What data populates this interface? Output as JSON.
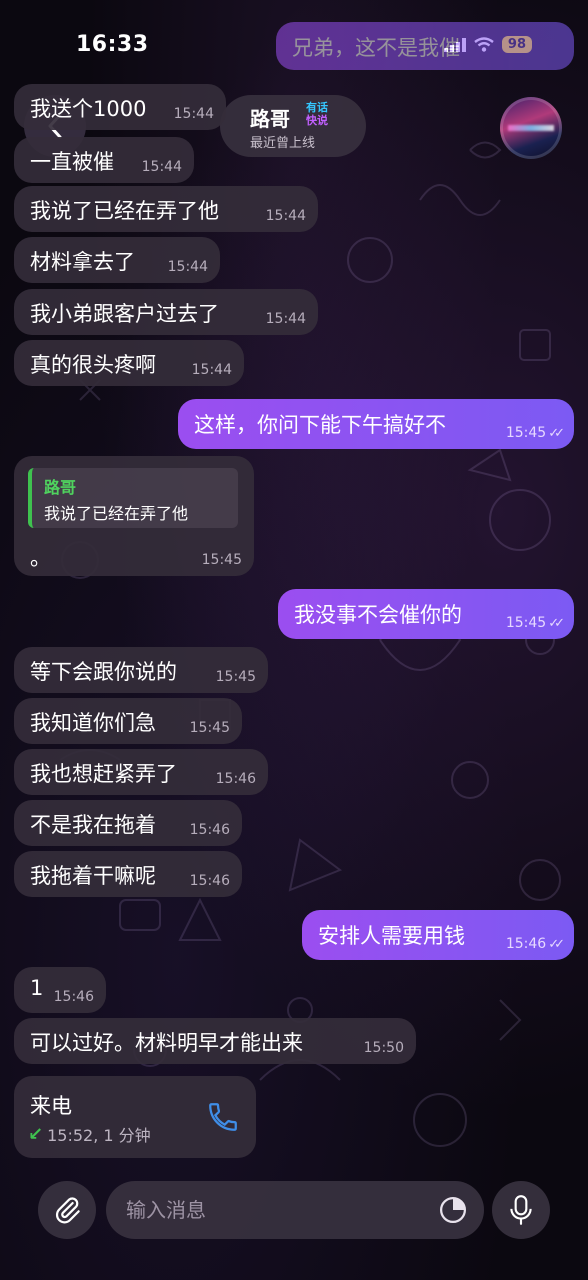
{
  "status_bar": {
    "time": "16:33",
    "battery": "98"
  },
  "header": {
    "back_icon": "chevron-left-icon",
    "contact_name": "路哥",
    "badge_line1": "有话",
    "badge_line2": "快说",
    "contact_status": "最近曾上线"
  },
  "messages": [
    {
      "dir": "out",
      "text": "兄弟，这不是我催",
      "time": "",
      "faded": true
    },
    {
      "dir": "in",
      "text": "我送个1000",
      "time": "15:44"
    },
    {
      "dir": "in",
      "text": "一直被催",
      "time": "15:44"
    },
    {
      "dir": "in",
      "text": "我说了已经在弄了他",
      "time": "15:44"
    },
    {
      "dir": "in",
      "text": "材料拿去了",
      "time": "15:44"
    },
    {
      "dir": "in",
      "text": "我小弟跟客户过去了",
      "time": "15:44"
    },
    {
      "dir": "in",
      "text": "真的很头疼啊",
      "time": "15:44"
    },
    {
      "dir": "out",
      "text": "这样，你问下能下午搞好不",
      "time": "15:45"
    },
    {
      "dir": "in",
      "reply_name": "路哥",
      "reply_text": "我说了已经在弄了他",
      "text": "。",
      "time": "15:45"
    },
    {
      "dir": "out",
      "text": "我没事不会催你的",
      "time": "15:45"
    },
    {
      "dir": "in",
      "text": "等下会跟你说的",
      "time": "15:45"
    },
    {
      "dir": "in",
      "text": "我知道你们急",
      "time": "15:45"
    },
    {
      "dir": "in",
      "text": "我也想赶紧弄了",
      "time": "15:46"
    },
    {
      "dir": "in",
      "text": "不是我在拖着",
      "time": "15:46"
    },
    {
      "dir": "in",
      "text": "我拖着干嘛呢",
      "time": "15:46"
    },
    {
      "dir": "out",
      "text": "安排人需要用钱",
      "time": "15:46"
    },
    {
      "dir": "in",
      "text": "1",
      "time": "15:46"
    },
    {
      "dir": "in",
      "text": "可以过好。材料明早才能出来",
      "time": "15:50"
    }
  ],
  "call": {
    "title": "来电",
    "meta": "15:52, 1 分钟",
    "icon": "phone-icon"
  },
  "composer": {
    "placeholder": "输入消息",
    "attach_icon": "paperclip-icon",
    "sticker_icon": "sticker-icon",
    "mic_icon": "microphone-icon"
  },
  "colors": {
    "outgoing_bubble": "#8e55f2",
    "incoming_bubble": "#342c3a",
    "reply_accent": "#3fc24f",
    "link_blue": "#3f8ee8"
  }
}
